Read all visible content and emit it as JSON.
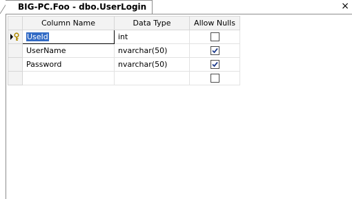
{
  "tab": {
    "title": "BIG-PC.Foo - dbo.UserLogin",
    "close_glyph": "×"
  },
  "grid": {
    "headers": {
      "column_name": "Column Name",
      "data_type": "Data Type",
      "allow_nulls": "Allow Nulls"
    },
    "rows": [
      {
        "column_name": "UseId",
        "data_type": "int",
        "allow_nulls": false,
        "primary_key": true,
        "current": true
      },
      {
        "column_name": "UserName",
        "data_type": "nvarchar(50)",
        "allow_nulls": true
      },
      {
        "column_name": "Password",
        "data_type": "nvarchar(50)",
        "allow_nulls": true
      },
      {
        "column_name": "",
        "data_type": "",
        "allow_nulls": false
      }
    ]
  },
  "colors": {
    "selection": "#316ac5",
    "header_bg": "#f3f3f3",
    "grid_line": "#e2e2e2",
    "key_icon": "#d4b000"
  }
}
